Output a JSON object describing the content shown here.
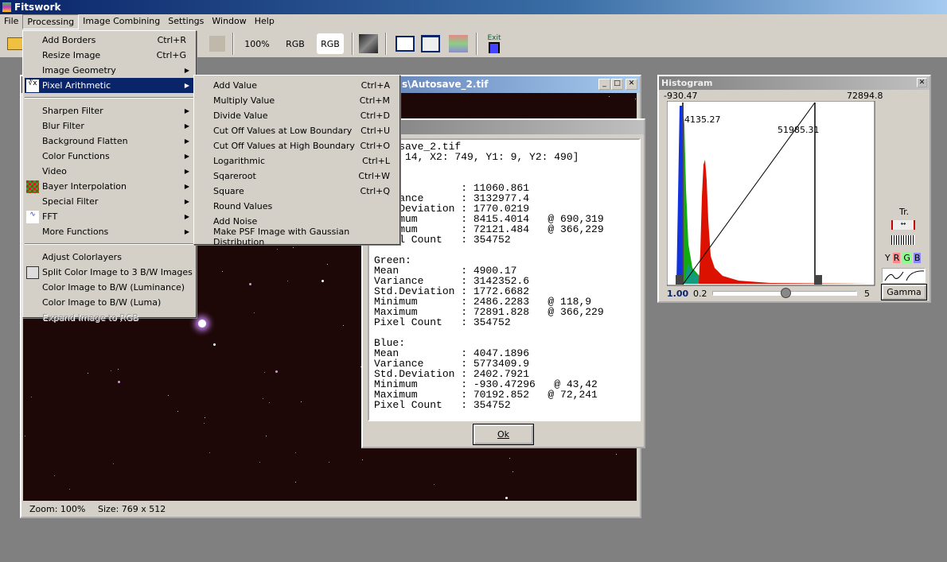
{
  "app": {
    "title": "Fitswork"
  },
  "menubar": [
    "File",
    "Processing",
    "Image Combining",
    "Settings",
    "Window",
    "Help"
  ],
  "toolbar": {
    "zoom": "100%",
    "rgb1": "RGB",
    "rgb2": "RGB",
    "exit": "Exit"
  },
  "processing_menu": [
    {
      "label": "Add Borders",
      "shortcut": "Ctrl+R"
    },
    {
      "label": "Resize Image",
      "shortcut": "Ctrl+G"
    },
    {
      "label": "Image Geometry",
      "submenu": true
    },
    {
      "label": "Pixel Arithmetic",
      "submenu": true,
      "icon": "cube-root-icon",
      "highlighted": true
    },
    {
      "separator": true
    },
    {
      "label": "Sharpen Filter",
      "submenu": true
    },
    {
      "label": "Blur Filter",
      "submenu": true
    },
    {
      "label": "Background Flatten",
      "submenu": true
    },
    {
      "label": "Color Functions",
      "submenu": true
    },
    {
      "label": "Video",
      "submenu": true
    },
    {
      "label": "Bayer Interpolation",
      "submenu": true,
      "icon": "bayer-grid-icon"
    },
    {
      "label": "Special Filter",
      "submenu": true
    },
    {
      "label": "FFT",
      "submenu": true,
      "icon": "wave-icon"
    },
    {
      "label": "More Functions",
      "submenu": true
    },
    {
      "separator": true
    },
    {
      "label": "Adjust Colorlayers"
    },
    {
      "label": "Split Color Image to 3 B/W Images",
      "icon": "split-icon"
    },
    {
      "label": "Color Image to B/W (Luminance)"
    },
    {
      "label": "Color Image to B/W (Luma)"
    },
    {
      "label": "Expand Image to RGB",
      "disabled": true
    }
  ],
  "pixel_arithmetic_menu": [
    {
      "label": "Add Value",
      "shortcut": "Ctrl+A"
    },
    {
      "label": "Multiply Value",
      "shortcut": "Ctrl+M"
    },
    {
      "label": "Divide Value",
      "shortcut": "Ctrl+D"
    },
    {
      "label": "Cut Off Values at Low Boundary",
      "shortcut": "Ctrl+U"
    },
    {
      "label": "Cut Off Values at High Boundary",
      "shortcut": "Ctrl+O"
    },
    {
      "label": "Logarithmic",
      "shortcut": "Ctrl+L"
    },
    {
      "label": "Sqareroot",
      "shortcut": "Ctrl+W"
    },
    {
      "label": "Square",
      "shortcut": "Ctrl+Q"
    },
    {
      "label": "Round Values"
    },
    {
      "label": "Add Noise"
    },
    {
      "label": "Make PSF Image with Gaussian Distribution"
    }
  ],
  "image_window": {
    "title": "s\\Autosave_2.tif",
    "zoom": "Zoom: 100%",
    "size": "Size: 769 x 512"
  },
  "stats_dialog": {
    "lines": [
      "    save_2.tif",
      "     14, X2: 749, Y1: 9, Y2: 490]",
      "",
      "",
      "              : 11060.861",
      "    ance      : 3132977.4",
      "    Deviation : 1770.0219",
      "    mum       : 8415.4014   @ 690,319",
      "    mum       : 72121.484   @ 366,229",
      "    l Count   : 354752",
      "",
      "Green:",
      "Mean          : 4900.17",
      "Variance      : 3142352.6",
      "Std.Deviation : 1772.6682",
      "Minimum       : 2486.2283   @ 118,9",
      "Maximum       : 72891.828   @ 366,229",
      "Pixel Count   : 354752",
      "",
      "Blue:",
      "Mean          : 4047.1896",
      "Variance      : 5773409.9",
      "Std.Deviation : 2402.7921",
      "Minimum       : -930.47296   @ 43,42",
      "Maximum       : 70192.852   @ 72,241",
      "Pixel Count   : 354752"
    ],
    "ok": "Ok"
  },
  "histogram": {
    "title": "Histogram",
    "min": "-930.47",
    "max": "72894.8",
    "black_point": "4135.27",
    "white_point": "51985.31",
    "gamma_value": "1.00",
    "slider_min": "0.2",
    "slider_max": "5",
    "slider_position": 0.5,
    "tr": "Tr.",
    "channels": [
      "Y",
      "R",
      "G",
      "B"
    ],
    "gamma_button": "Gamma",
    "colors": {
      "red": "#dd1100",
      "green": "#11aa11",
      "blue": "#1133dd"
    }
  }
}
